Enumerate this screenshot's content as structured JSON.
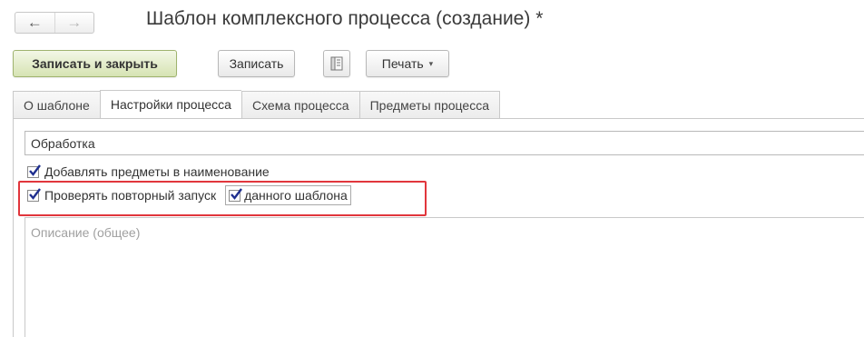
{
  "window": {
    "back_icon": "←",
    "forward_icon": "→",
    "title": "Шаблон комплексного процесса (создание) *"
  },
  "toolbar": {
    "save_close_label": "Записать и закрыть",
    "save_label": "Записать",
    "report_icon": "document-list-icon",
    "print_label": "Печать",
    "print_caret": "▾"
  },
  "tabs": [
    {
      "label": "О шаблоне",
      "active": false
    },
    {
      "label": "Настройки процесса",
      "active": true
    },
    {
      "label": "Схема процесса",
      "active": false
    },
    {
      "label": "Предметы процесса",
      "active": false
    }
  ],
  "form": {
    "processing_value": "Обработка",
    "add_subjects_label": "Добавлять предметы в наименование",
    "add_subjects_checked": true,
    "check_restart_label": "Проверять повторный запуск",
    "check_restart_checked": true,
    "this_template_label": "данного шаблона",
    "this_template_checked": true,
    "description_placeholder": "Описание (общее)"
  },
  "colors": {
    "check_mark": "#1f2f8f",
    "highlight_border": "#e1363c",
    "primary_button": "#d6e3b3"
  }
}
